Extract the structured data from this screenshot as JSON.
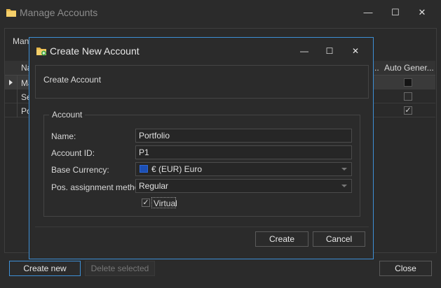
{
  "main_window": {
    "title": "Manage Accounts",
    "header_text": "Mana",
    "grid": {
      "columns": [
        "Na",
        "..",
        "Auto Gener..."
      ],
      "rows": [
        {
          "name": "Ma",
          "selected": true,
          "auto_generated": "filled"
        },
        {
          "name": "Se",
          "selected": false,
          "auto_generated": "unchecked"
        },
        {
          "name": "Po",
          "selected": false,
          "auto_generated": "checked"
        }
      ]
    },
    "buttons": {
      "create_new": "Create new",
      "delete_selected": "Delete selected",
      "close": "Close"
    }
  },
  "dialog": {
    "title": "Create New Account",
    "header_text": "Create Account",
    "group_title": "Account",
    "fields": {
      "name_label": "Name:",
      "name_value": "Portfolio",
      "account_id_label": "Account ID:",
      "account_id_value": "P1",
      "base_currency_label": "Base Currency:",
      "base_currency_value": "€ (EUR) Euro",
      "pos_assignment_label": "Pos. assignment method",
      "pos_assignment_value": "Regular",
      "virtual_label": "Virtual",
      "virtual_checked": true
    },
    "buttons": {
      "create": "Create",
      "cancel": "Cancel"
    }
  },
  "icons": {
    "main_title": "folder-icon",
    "dialog_title": "folder-add-icon",
    "minimize": "minimize-icon",
    "maximize": "maximize-icon",
    "close": "close-icon",
    "currency_flag": "eu-flag-icon",
    "row_pointer": "row-pointer-icon"
  },
  "colors": {
    "background": "#2b2b2b",
    "accent_border": "#3d8fd6",
    "text": "#d8d8d8",
    "disabled_text": "#777777"
  }
}
